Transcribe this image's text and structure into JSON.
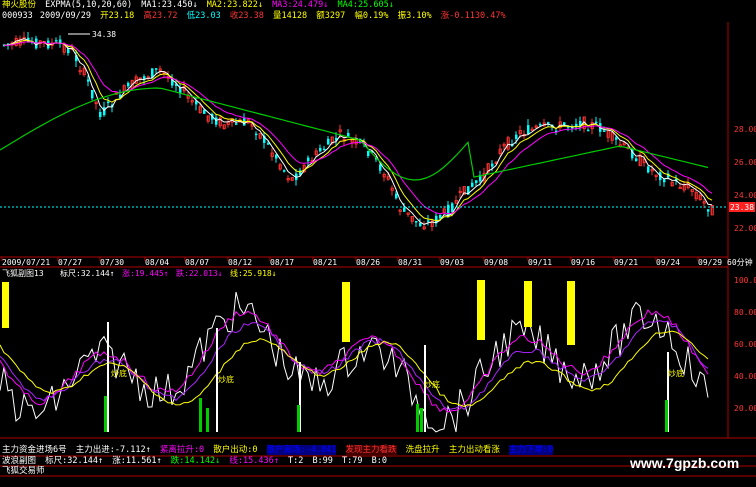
{
  "header": {
    "stock_name": "神火股份",
    "ema_label": "EXPMA(5,10,20,60)",
    "ma1": "MA1:23.450↓",
    "ma2": "MA2:23.822↓",
    "ma3": "MA3:24.479↓",
    "ma4": "MA4:25.605↓",
    "code": "000933",
    "date": "2009/09/29",
    "open": "开23.18",
    "high": "高23.72",
    "low": "低23.03",
    "close": "收23.38",
    "volume": "量14128",
    "amount": "额3297",
    "change_pct": "幅0.19%",
    "amplitude": "振3.10%",
    "rise": "涨-0.1130.47%"
  },
  "main_chart": {
    "max_marker": "34.38",
    "last_price_tag": "23.38",
    "y_ticks": [
      "28.00",
      "26.00",
      "24.00",
      "22.00"
    ],
    "x_labels": [
      "2009/07/21",
      "07/27",
      "07/30",
      "08/04",
      "08/07",
      "08/12",
      "08/17",
      "08/21",
      "08/26",
      "08/31",
      "09/03",
      "09/08",
      "09/11",
      "09/16",
      "09/21",
      "09/24",
      "09/29"
    ],
    "period": "60分钟"
  },
  "indicator1": {
    "title": "飞狐副图13",
    "v1": "标尺:32.144↑",
    "v2": "涨:19.445↑",
    "v3": "跌:22.013↓",
    "v4": "线:25.918↓",
    "y_ticks": [
      "100.00",
      "80.00",
      "60.00",
      "40.00",
      "20.00"
    ],
    "annotations": [
      "炒底",
      "炒底",
      "炒底",
      "炒底"
    ]
  },
  "bottom": {
    "line1": [
      "主力资金进场6号",
      "主力出进:-7.112↑",
      "紧离拉升:0",
      "散户出动:0",
      "散户离场:-4.841",
      "发现主力看跌",
      "洗盘拉升",
      "主力出动看涨",
      "主力下单:0"
    ],
    "line2": [
      "波浪副图",
      "标尺:32.144↑",
      "涨:11.561↑",
      "跌:14.142↓",
      "线:15.436↑",
      "T:2",
      "B:99",
      "T:79",
      "B:0"
    ],
    "line3": [
      "飞狐交易师"
    ],
    "watermark": "www.7gpzb.com"
  },
  "colors": {
    "up": "#ff3333",
    "down": "#00ffff",
    "ma1": "#ffffff",
    "ma2": "#ffff00",
    "ma3": "#ff00ff",
    "ma4": "#00cc00",
    "axis": "#b00000",
    "signal": "#ffff00"
  }
}
